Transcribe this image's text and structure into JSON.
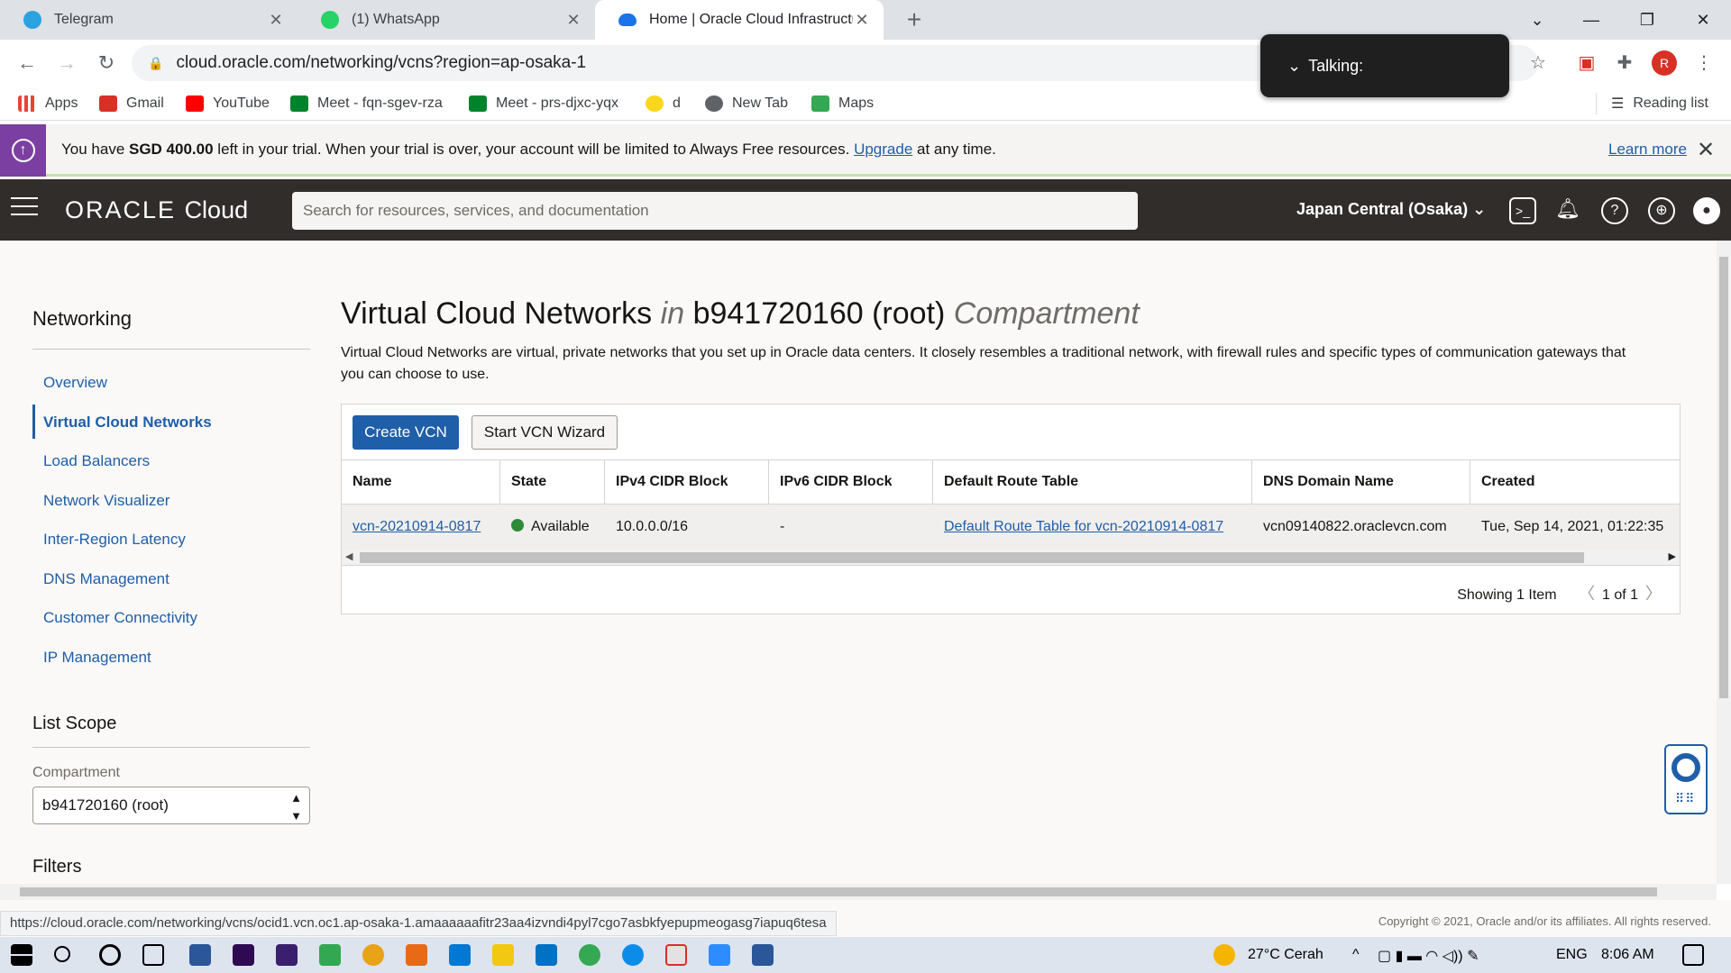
{
  "browser": {
    "tabs": [
      {
        "label": "Telegram",
        "color": "#2aa3e0"
      },
      {
        "label": "(1) WhatsApp",
        "color": "#25d366"
      },
      {
        "label": "Home | Oracle Cloud Infrastructu",
        "color": "#1a73e8"
      }
    ],
    "url": "cloud.oracle.com/networking/vcns?region=ap-osaka-1",
    "bookmarks": [
      {
        "label": "Apps",
        "color": "#ea4335"
      },
      {
        "label": "Gmail",
        "color": "#d93025"
      },
      {
        "label": "YouTube",
        "color": "#ff0000"
      },
      {
        "label": "Meet - fqn-sgev-rza",
        "color": "#00832d"
      },
      {
        "label": "Meet - prs-djxc-yqx",
        "color": "#00832d"
      },
      {
        "label": "d",
        "color": "#f9d71c"
      },
      {
        "label": "New Tab",
        "color": "#5f6368"
      },
      {
        "label": "Maps",
        "color": "#34a853"
      }
    ],
    "reading_list": "Reading list",
    "profile_initial": "R"
  },
  "talking_popup": "Talking:",
  "trial_banner": {
    "prefix": "You have ",
    "amount": "SGD 400.00",
    "middle": " left in your trial. When your trial is over, your account will be limited to Always Free resources. ",
    "upgrade": "Upgrade",
    "suffix": " at any time.",
    "learn_more": "Learn more"
  },
  "header": {
    "brand": "ORACLE",
    "brand_cloud": "Cloud",
    "search_placeholder": "Search for resources, services, and documentation",
    "region": "Japan Central (Osaka)"
  },
  "sidebar": {
    "title": "Networking",
    "items": [
      {
        "label": "Overview"
      },
      {
        "label": "Virtual Cloud Networks",
        "active": true
      },
      {
        "label": "Load Balancers"
      },
      {
        "label": "Network Visualizer"
      },
      {
        "label": "Inter-Region Latency"
      },
      {
        "label": "DNS Management"
      },
      {
        "label": "Customer Connectivity"
      },
      {
        "label": "IP Management"
      }
    ],
    "list_scope_title": "List Scope",
    "compartment_label": "Compartment",
    "compartment_value": "b941720160 (root)",
    "filters_title": "Filters"
  },
  "main": {
    "title": "Virtual Cloud Networks",
    "title_in": "in",
    "title_compartment": "b941720160 (root)",
    "title_suffix": "Compartment",
    "description": "Virtual Cloud Networks are virtual, private networks that you set up in Oracle data centers. It closely resembles a traditional network, with firewall rules and specific types of communication gateways that you can choose to use.",
    "create_button": "Create VCN",
    "wizard_button": "Start VCN Wizard",
    "columns": [
      "Name",
      "State",
      "IPv4 CIDR Block",
      "IPv6 CIDR Block",
      "Default Route Table",
      "DNS Domain Name",
      "Created"
    ],
    "rows": [
      {
        "name": "vcn-20210914-0817",
        "state": "Available",
        "ipv4": "10.0.0.0/16",
        "ipv6": "-",
        "route_table": "Default Route Table for vcn-20210914-0817",
        "dns": "vcn09140822.oraclevcn.com",
        "created": "Tue, Sep 14, 2021, 01:22:35"
      }
    ],
    "showing": "Showing 1 Item",
    "page": "1 of 1"
  },
  "status": {
    "url": "https://cloud.oracle.com/networking/vcns/ocid1.vcn.oc1.ap-osaka-1.amaaaaaafitr23aa4izvndi4pyl7cgo7asbkfyepupmeogasg7iapuq6tesa",
    "copyright": "Copyright © 2021, Oracle and/or its affiliates. All rights reserved."
  },
  "taskbar": {
    "weather": "27°C  Cerah",
    "lang": "ENG",
    "time": "8:06 AM"
  },
  "colors": {
    "oracle_header": "#312d2a",
    "link": "#1f5ea8",
    "primary_button": "#1f5ea8",
    "available": "#2f8a3a",
    "trial_accent": "#7b3fa1"
  }
}
